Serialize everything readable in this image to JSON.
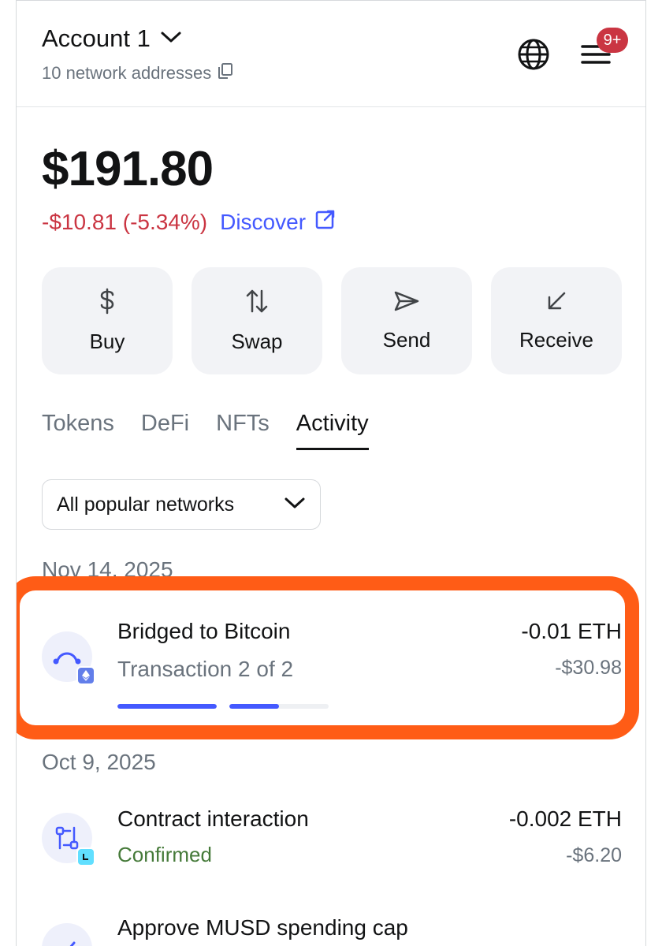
{
  "header": {
    "account_name": "Account 1",
    "network_addresses": "10 network addresses",
    "notification_badge": "9+"
  },
  "balance": {
    "total": "$191.80",
    "change": "-$10.81 (-5.34%)",
    "discover_label": "Discover"
  },
  "actions": [
    {
      "label": "Buy",
      "icon": "dollar-icon"
    },
    {
      "label": "Swap",
      "icon": "swap-arrows-icon"
    },
    {
      "label": "Send",
      "icon": "send-icon"
    },
    {
      "label": "Receive",
      "icon": "receive-arrow-icon"
    }
  ],
  "tabs": [
    {
      "label": "Tokens",
      "active": false
    },
    {
      "label": "DeFi",
      "active": false
    },
    {
      "label": "NFTs",
      "active": false
    },
    {
      "label": "Activity",
      "active": true
    }
  ],
  "filter": {
    "label": "All popular networks"
  },
  "activity": {
    "groups": [
      {
        "date": "Nov 14, 2025",
        "items": [
          {
            "title": "Bridged to Bitcoin",
            "subtitle": "Transaction 2 of 2",
            "amount": "-0.01 ETH",
            "fiat": "-$30.98",
            "progress": [
              1.0,
              0.5
            ]
          }
        ]
      },
      {
        "date": "Oct 9, 2025",
        "items": [
          {
            "title": "Contract interaction",
            "status": "Confirmed",
            "amount": "-0.002 ETH",
            "fiat": "-$6.20"
          },
          {
            "title": "Approve MUSD spending cap"
          }
        ]
      }
    ]
  },
  "colors": {
    "negative": "#ca3542",
    "link": "#4459ff",
    "confirmed": "#457a39",
    "highlight": "#ff5c16",
    "badge": "#ca3542"
  }
}
